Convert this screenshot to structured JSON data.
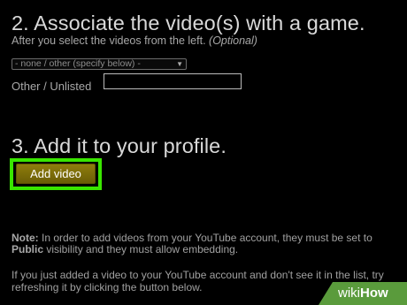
{
  "section_associate": {
    "title": "2. Associate the video(s) with a game.",
    "helper": "After you select the videos from the left. ",
    "optional": "(Optional)",
    "select_value": "- none / other (specify below) -",
    "select_arrow_icon": "triangle-down",
    "other_label": "Other / Unlisted",
    "other_value": ""
  },
  "section_profile": {
    "title": "3. Add it to your profile.",
    "add_button_label": "Add video",
    "highlight_color": "#39e600"
  },
  "notes": {
    "note_label": "Note:",
    "note_text_1": " In order to add videos from your YouTube account, they must be set to ",
    "note_public": "Public",
    "note_text_2": " visibility and they must allow embedding.",
    "refresh_text": "If you just added a video to your YouTube account and don't see it in the list, try refreshing it by clicking the button below."
  },
  "watermark": {
    "part1": "wiki",
    "part2": "How",
    "color": "#5a9b3c"
  }
}
